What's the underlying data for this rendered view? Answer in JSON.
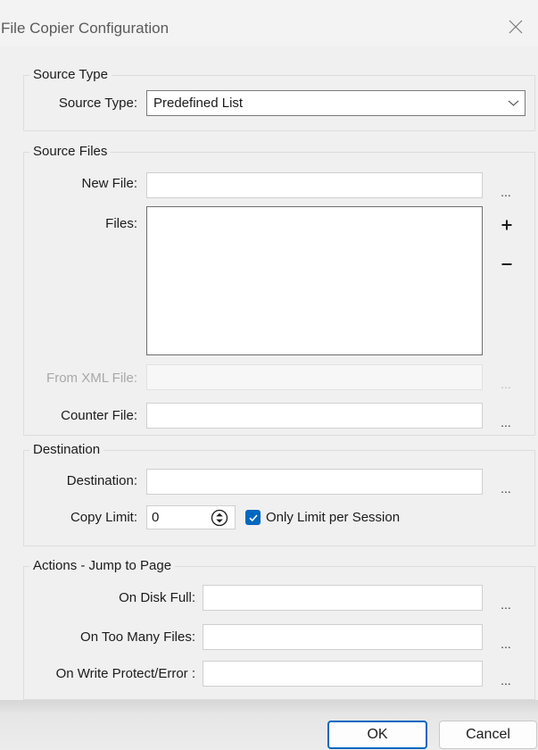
{
  "window": {
    "title": "File Copier Configuration"
  },
  "source_type": {
    "legend": "Source Type",
    "label": "Source Type:",
    "selected": "Predefined List"
  },
  "source_files": {
    "legend": "Source Files",
    "new_file_label": "New File:",
    "new_file_value": "",
    "new_file_browse": "...",
    "files_label": "Files:",
    "files": [],
    "from_xml_label": "From XML File:",
    "from_xml_value": "",
    "from_xml_browse": "...",
    "counter_file_label": "Counter File:",
    "counter_file_value": "",
    "counter_file_browse": "..."
  },
  "destination": {
    "legend": "Destination",
    "destination_label": "Destination:",
    "destination_value": "",
    "destination_browse": "...",
    "copy_limit_label": "Copy Limit:",
    "copy_limit_value": "0",
    "only_limit_label": "Only Limit per Session",
    "only_limit_checked": true
  },
  "actions": {
    "legend": "Actions - Jump to Page",
    "disk_full_label": "On Disk Full:",
    "disk_full_value": "",
    "disk_full_browse": "...",
    "too_many_label": "On Too Many Files:",
    "too_many_value": "",
    "too_many_browse": "...",
    "write_protect_label": "On Write Protect/Error :",
    "write_protect_value": "",
    "write_protect_browse": "..."
  },
  "buttons": {
    "ok": "OK",
    "cancel": "Cancel"
  },
  "colors": {
    "accent": "#0067c0",
    "window_bg": "#f0f0f0",
    "group_border": "#dcdcdc",
    "disabled_text": "#a8a8a8"
  },
  "icons": {
    "close": "close-icon",
    "dropdown": "chevron-down-icon",
    "add": "plus-icon",
    "remove": "minus-icon",
    "spinner": "spinner-up-down-icon",
    "check": "checkmark-icon"
  }
}
